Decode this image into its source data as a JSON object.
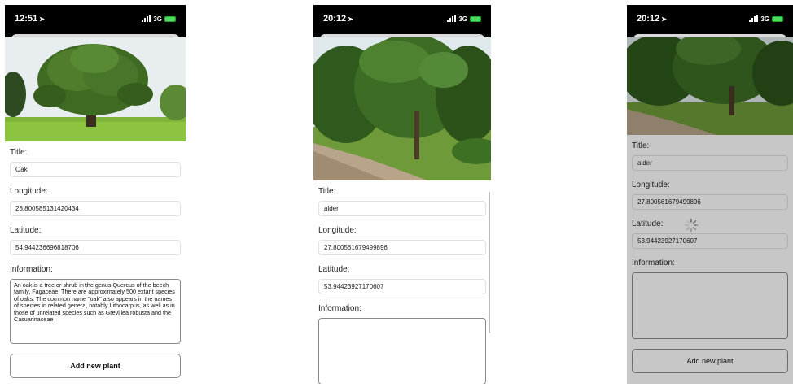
{
  "screens": [
    {
      "time": "12:51",
      "network": "3G",
      "title_label": "Title:",
      "title_value": "Oak",
      "longitude_label": "Longitude:",
      "longitude_value": "28.800585131420434",
      "latitude_label": "Latitude:",
      "latitude_value": "54.944236696818706",
      "information_label": "Information:",
      "information_value": "An oak is a tree or shrub in the genus Quercus of the beech family, Fagaceae. There are approximately 500 extant species of oaks. The common name \"oak\" also appears in the names of species in related genera, notably Lithocarpus, as well as in those of unrelated species such as Grevillea robusta and the Casuarinaceae",
      "add_button": "Add new plant"
    },
    {
      "time": "20:12",
      "network": "3G",
      "title_label": "Title:",
      "title_value": "alder",
      "longitude_label": "Longitude:",
      "longitude_value": "27.800561679499896",
      "latitude_label": "Latitude:",
      "latitude_value": "53.94423927170607",
      "information_label": "Information:",
      "information_value": ""
    },
    {
      "time": "20:12",
      "network": "3G",
      "title_label": "Title:",
      "title_value": "alder",
      "longitude_label": "Longitude:",
      "longitude_value": "27.800561679499896",
      "latitude_label": "Latitude:",
      "latitude_value": "53.94423927170607",
      "information_label": "Information:",
      "information_value": "",
      "add_button": "Add new plant"
    }
  ],
  "icons": {
    "location_arrow": "location-arrow-icon",
    "signal": "signal-bars-icon",
    "battery": "battery-icon",
    "spinner": "loading-spinner-icon"
  },
  "colors": {
    "battery": "#4cd964",
    "statusbar": "#000000",
    "overlay": "rgba(0,0,0,0.22)"
  }
}
